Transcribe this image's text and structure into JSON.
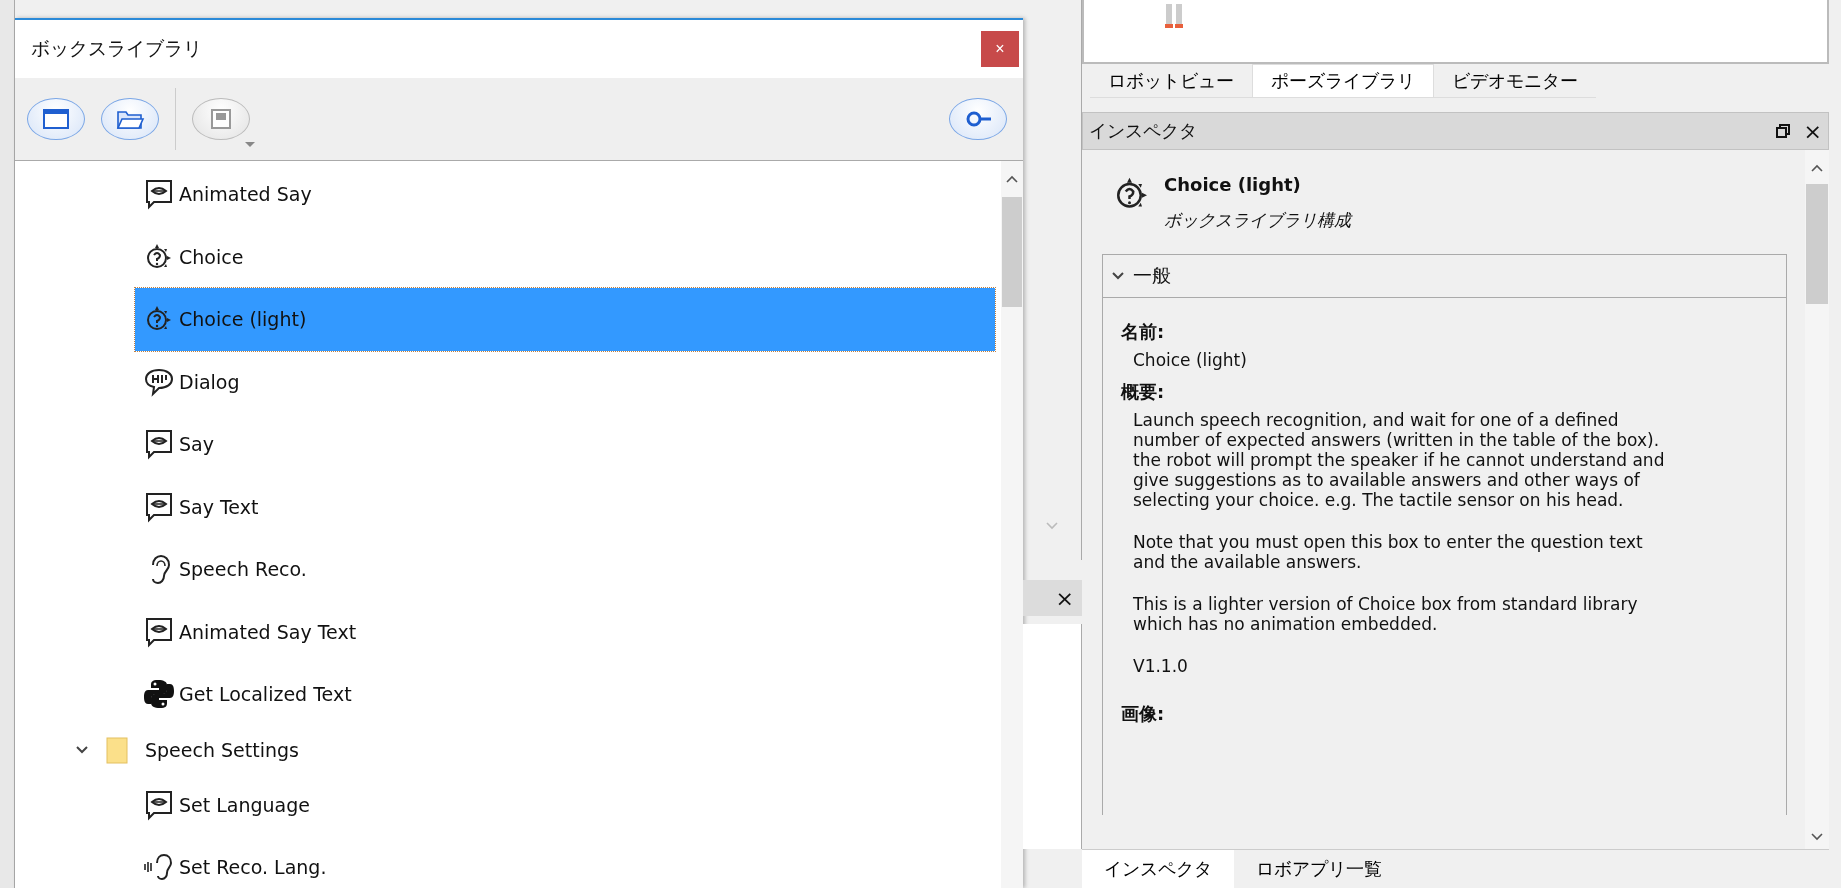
{
  "box_library": {
    "title": "ボックスライブラリ",
    "close": "×",
    "toolbar": [
      {
        "kind": "window",
        "disabled": false
      },
      {
        "kind": "folder",
        "disabled": false
      },
      {
        "kind": "save",
        "disabled": true
      },
      {
        "kind": "search",
        "disabled": false
      }
    ],
    "tree": [
      {
        "children": [
          {
            "label": "Animated Say",
            "kind": "say",
            "selected": false
          },
          {
            "label": "Choice",
            "kind": "choice",
            "selected": false
          },
          {
            "label": "Choice (light)",
            "kind": "choice",
            "selected": true
          },
          {
            "label": "Dialog",
            "kind": "dialog",
            "selected": false
          },
          {
            "label": "Say",
            "kind": "say",
            "selected": false
          },
          {
            "label": "Say Text",
            "kind": "say",
            "selected": false
          },
          {
            "label": "Speech Reco.",
            "kind": "ear",
            "selected": false
          },
          {
            "label": "Animated Say Text",
            "kind": "say",
            "selected": false
          },
          {
            "label": "Get Localized Text",
            "kind": "python",
            "selected": false
          }
        ]
      },
      {
        "label": "Speech Settings",
        "kind": "folder",
        "expanded": true,
        "selected": false,
        "children": [
          {
            "label": "Set Language",
            "kind": "say",
            "selected": false
          },
          {
            "label": "Set Reco. Lang.",
            "kind": "listen",
            "selected": false
          }
        ]
      }
    ]
  },
  "side_panel": {
    "close": "×"
  },
  "view_tabs": [
    {
      "label": "ロボットビュー",
      "selected": false
    },
    {
      "label": "ポーズライブラリ",
      "selected": true
    },
    {
      "label": "ビデオモニター",
      "selected": false
    }
  ],
  "inspector": {
    "title": "インスペクタ",
    "close": "×",
    "box_name": "Choice (light)",
    "box_source": "ボックスライブラリ構成",
    "section": {
      "title": "一般",
      "expanded": true
    },
    "fields": [
      {
        "label": "名前:",
        "paragraphs": [
          "Choice (light)"
        ]
      },
      {
        "label": "概要:",
        "paragraphs": [
          "Launch speech recognition, and wait for one of a defined number of expected answers (written in the table of the box). the robot will prompt the speaker if he cannot understand and give suggestions as to available answers and other ways of selecting your choice. e.g. The tactile sensor on his head.",
          "Note that you must open this box to enter the question text and the available answers.",
          "This is a lighter version of Choice box from standard library which has no animation embedded.",
          "V1.1.0"
        ]
      },
      {
        "label": "画像:"
      }
    ]
  },
  "bottom_tabs": [
    {
      "label": "インスペクタ",
      "selected": true
    },
    {
      "label": "ロボアプリ一覧",
      "selected": false
    }
  ]
}
